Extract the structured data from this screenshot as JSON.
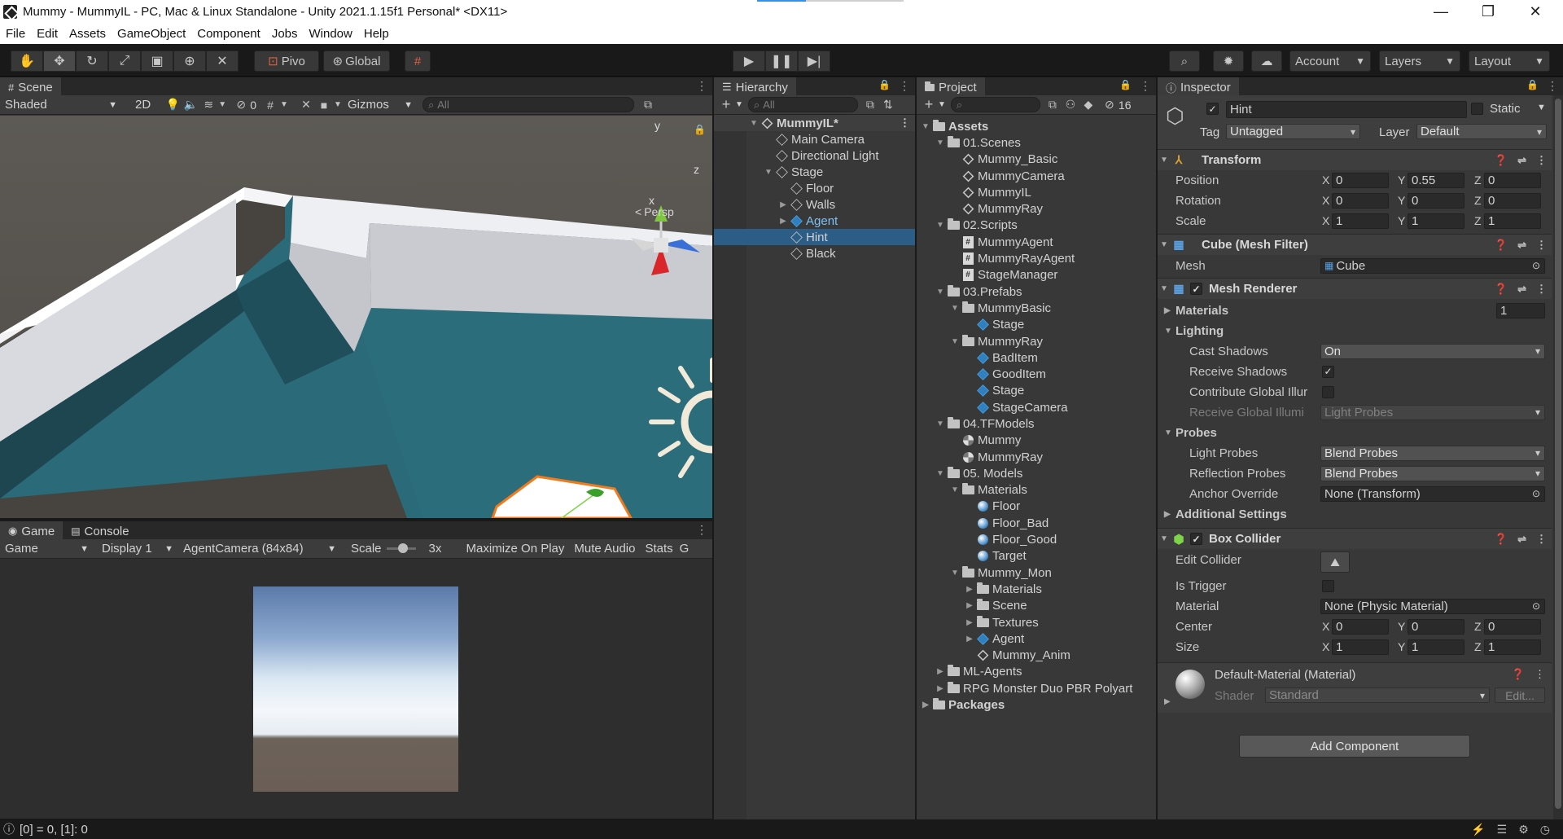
{
  "window": {
    "title": "Mummy - MummyIL - PC, Mac & Linux Standalone - Unity 2021.1.15f1 Personal* <DX11>"
  },
  "menu": [
    "File",
    "Edit",
    "Assets",
    "GameObject",
    "Component",
    "Jobs",
    "Window",
    "Help"
  ],
  "toolbar": {
    "pivot_label": "Pivo",
    "global_label": "Global",
    "account_label": "Account",
    "layers_label": "Layers",
    "layout_label": "Layout"
  },
  "scene": {
    "tab_label": "Scene",
    "shading": "Shaded",
    "mode_2d": "2D",
    "hidden_count": "0",
    "gizmos_label": "Gizmos",
    "search_placeholder": "All",
    "persp_label": "Persp",
    "axis_x": "x",
    "axis_y": "y",
    "axis_z": "z"
  },
  "game": {
    "tab_label": "Game",
    "console_tab_label": "Console",
    "mode": "Game",
    "display": "Display 1",
    "resolution": "AgentCamera (84x84)",
    "scale_label": "Scale",
    "scale_value": "3x",
    "maximize": "Maximize On Play",
    "mute": "Mute Audio",
    "stats": "Stats",
    "cut": "G"
  },
  "hierarchy": {
    "tab_label": "Hierarchy",
    "search_placeholder": "All",
    "scene_name": "MummyIL*",
    "items": [
      {
        "label": "Main Camera",
        "depth": 1,
        "arrow": "",
        "sel": false,
        "blue": false
      },
      {
        "label": "Directional Light",
        "depth": 1,
        "arrow": "",
        "sel": false,
        "blue": false
      },
      {
        "label": "Stage",
        "depth": 1,
        "arrow": "▼",
        "sel": false,
        "blue": false
      },
      {
        "label": "Floor",
        "depth": 2,
        "arrow": "",
        "sel": false,
        "blue": false
      },
      {
        "label": "Walls",
        "depth": 2,
        "arrow": "▶",
        "sel": false,
        "blue": false
      },
      {
        "label": "Agent",
        "depth": 2,
        "arrow": "▶",
        "sel": false,
        "blue": true
      },
      {
        "label": "Hint",
        "depth": 2,
        "arrow": "",
        "sel": true,
        "blue": false
      },
      {
        "label": "Black",
        "depth": 2,
        "arrow": "",
        "sel": false,
        "blue": false
      }
    ]
  },
  "project": {
    "tab_label": "Project",
    "hidden_count": "16",
    "items": [
      {
        "label": "Assets",
        "depth": 0,
        "arrow": "▼",
        "icon": "folder",
        "bold": true
      },
      {
        "label": "01.Scenes",
        "depth": 1,
        "arrow": "▼",
        "icon": "folder"
      },
      {
        "label": "Mummy_Basic",
        "depth": 2,
        "arrow": "",
        "icon": "scene"
      },
      {
        "label": "MummyCamera",
        "depth": 2,
        "arrow": "",
        "icon": "scene"
      },
      {
        "label": "MummyIL",
        "depth": 2,
        "arrow": "",
        "icon": "scene"
      },
      {
        "label": "MummyRay",
        "depth": 2,
        "arrow": "",
        "icon": "scene"
      },
      {
        "label": "02.Scripts",
        "depth": 1,
        "arrow": "▼",
        "icon": "folder"
      },
      {
        "label": "MummyAgent",
        "depth": 2,
        "arrow": "",
        "icon": "script"
      },
      {
        "label": "MummyRayAgent",
        "depth": 2,
        "arrow": "",
        "icon": "script"
      },
      {
        "label": "StageManager",
        "depth": 2,
        "arrow": "",
        "icon": "script"
      },
      {
        "label": "03.Prefabs",
        "depth": 1,
        "arrow": "▼",
        "icon": "folder"
      },
      {
        "label": "MummyBasic",
        "depth": 2,
        "arrow": "▼",
        "icon": "folder"
      },
      {
        "label": "Stage",
        "depth": 3,
        "arrow": "",
        "icon": "prefab"
      },
      {
        "label": "MummyRay",
        "depth": 2,
        "arrow": "▼",
        "icon": "folder"
      },
      {
        "label": "BadItem",
        "depth": 3,
        "arrow": "",
        "icon": "prefab"
      },
      {
        "label": "GoodItem",
        "depth": 3,
        "arrow": "",
        "icon": "prefab"
      },
      {
        "label": "Stage",
        "depth": 3,
        "arrow": "",
        "icon": "prefab"
      },
      {
        "label": "StageCamera",
        "depth": 3,
        "arrow": "",
        "icon": "prefab"
      },
      {
        "label": "04.TFModels",
        "depth": 1,
        "arrow": "▼",
        "icon": "folder"
      },
      {
        "label": "Mummy",
        "depth": 2,
        "arrow": "",
        "icon": "model"
      },
      {
        "label": "MummyRay",
        "depth": 2,
        "arrow": "",
        "icon": "model"
      },
      {
        "label": "05. Models",
        "depth": 1,
        "arrow": "▼",
        "icon": "folder"
      },
      {
        "label": "Materials",
        "depth": 2,
        "arrow": "▼",
        "icon": "folder"
      },
      {
        "label": "Floor",
        "depth": 3,
        "arrow": "",
        "icon": "material"
      },
      {
        "label": "Floor_Bad",
        "depth": 3,
        "arrow": "",
        "icon": "material"
      },
      {
        "label": "Floor_Good",
        "depth": 3,
        "arrow": "",
        "icon": "material"
      },
      {
        "label": "Target",
        "depth": 3,
        "arrow": "",
        "icon": "material"
      },
      {
        "label": "Mummy_Mon",
        "depth": 2,
        "arrow": "▼",
        "icon": "folder"
      },
      {
        "label": "Materials",
        "depth": 3,
        "arrow": "▶",
        "icon": "folder"
      },
      {
        "label": "Scene",
        "depth": 3,
        "arrow": "▶",
        "icon": "folder"
      },
      {
        "label": "Textures",
        "depth": 3,
        "arrow": "▶",
        "icon": "folder"
      },
      {
        "label": "Agent",
        "depth": 3,
        "arrow": "▶",
        "icon": "prefab"
      },
      {
        "label": "Mummy_Anim",
        "depth": 3,
        "arrow": "",
        "icon": "anim"
      },
      {
        "label": "ML-Agents",
        "depth": 1,
        "arrow": "▶",
        "icon": "folder"
      },
      {
        "label": "RPG Monster Duo PBR Polyart",
        "depth": 1,
        "arrow": "▶",
        "icon": "folder"
      },
      {
        "label": "Packages",
        "depth": 0,
        "arrow": "▶",
        "icon": "folder",
        "bold": true
      }
    ]
  },
  "inspector": {
    "tab_label": "Inspector",
    "object_name": "Hint",
    "static_label": "Static",
    "tag_label": "Tag",
    "tag_value": "Untagged",
    "layer_label": "Layer",
    "layer_value": "Default",
    "transform": {
      "title": "Transform",
      "position_label": "Position",
      "rotation_label": "Rotation",
      "scale_label": "Scale",
      "position": {
        "x": "0",
        "y": "0.55",
        "z": "0"
      },
      "rotation": {
        "x": "0",
        "y": "0",
        "z": "0"
      },
      "scale": {
        "x": "1",
        "y": "1",
        "z": "1"
      }
    },
    "mesh_filter": {
      "title": "Cube (Mesh Filter)",
      "mesh_label": "Mesh",
      "mesh_value": "Cube"
    },
    "mesh_renderer": {
      "title": "Mesh Renderer",
      "materials_label": "Materials",
      "materials_count": "1",
      "lighting_label": "Lighting",
      "cast_shadows_label": "Cast Shadows",
      "cast_shadows_value": "On",
      "receive_shadows_label": "Receive Shadows",
      "contribute_gi_label": "Contribute Global Illur",
      "receive_gi_label": "Receive Global Illumi",
      "receive_gi_value": "Light Probes",
      "probes_label": "Probes",
      "light_probes_label": "Light Probes",
      "light_probes_value": "Blend Probes",
      "reflection_probes_label": "Reflection Probes",
      "reflection_probes_value": "Blend Probes",
      "anchor_override_label": "Anchor Override",
      "anchor_override_value": "None (Transform)",
      "additional_label": "Additional Settings"
    },
    "box_collider": {
      "title": "Box Collider",
      "edit_collider_label": "Edit Collider",
      "is_trigger_label": "Is Trigger",
      "material_label": "Material",
      "material_value": "None (Physic Material)",
      "center_label": "Center",
      "size_label": "Size",
      "center": {
        "x": "0",
        "y": "0",
        "z": "0"
      },
      "size": {
        "x": "1",
        "y": "1",
        "z": "1"
      }
    },
    "material": {
      "title": "Default-Material (Material)",
      "shader_label": "Shader",
      "shader_value": "Standard",
      "edit_label": "Edit..."
    },
    "add_component": "Add Component"
  },
  "status": {
    "text": "[0] = 0, [1]: 0"
  },
  "colors": {
    "selection": "#2c5d87",
    "floor": "#2b6a78",
    "wall": "#e9eaee"
  }
}
